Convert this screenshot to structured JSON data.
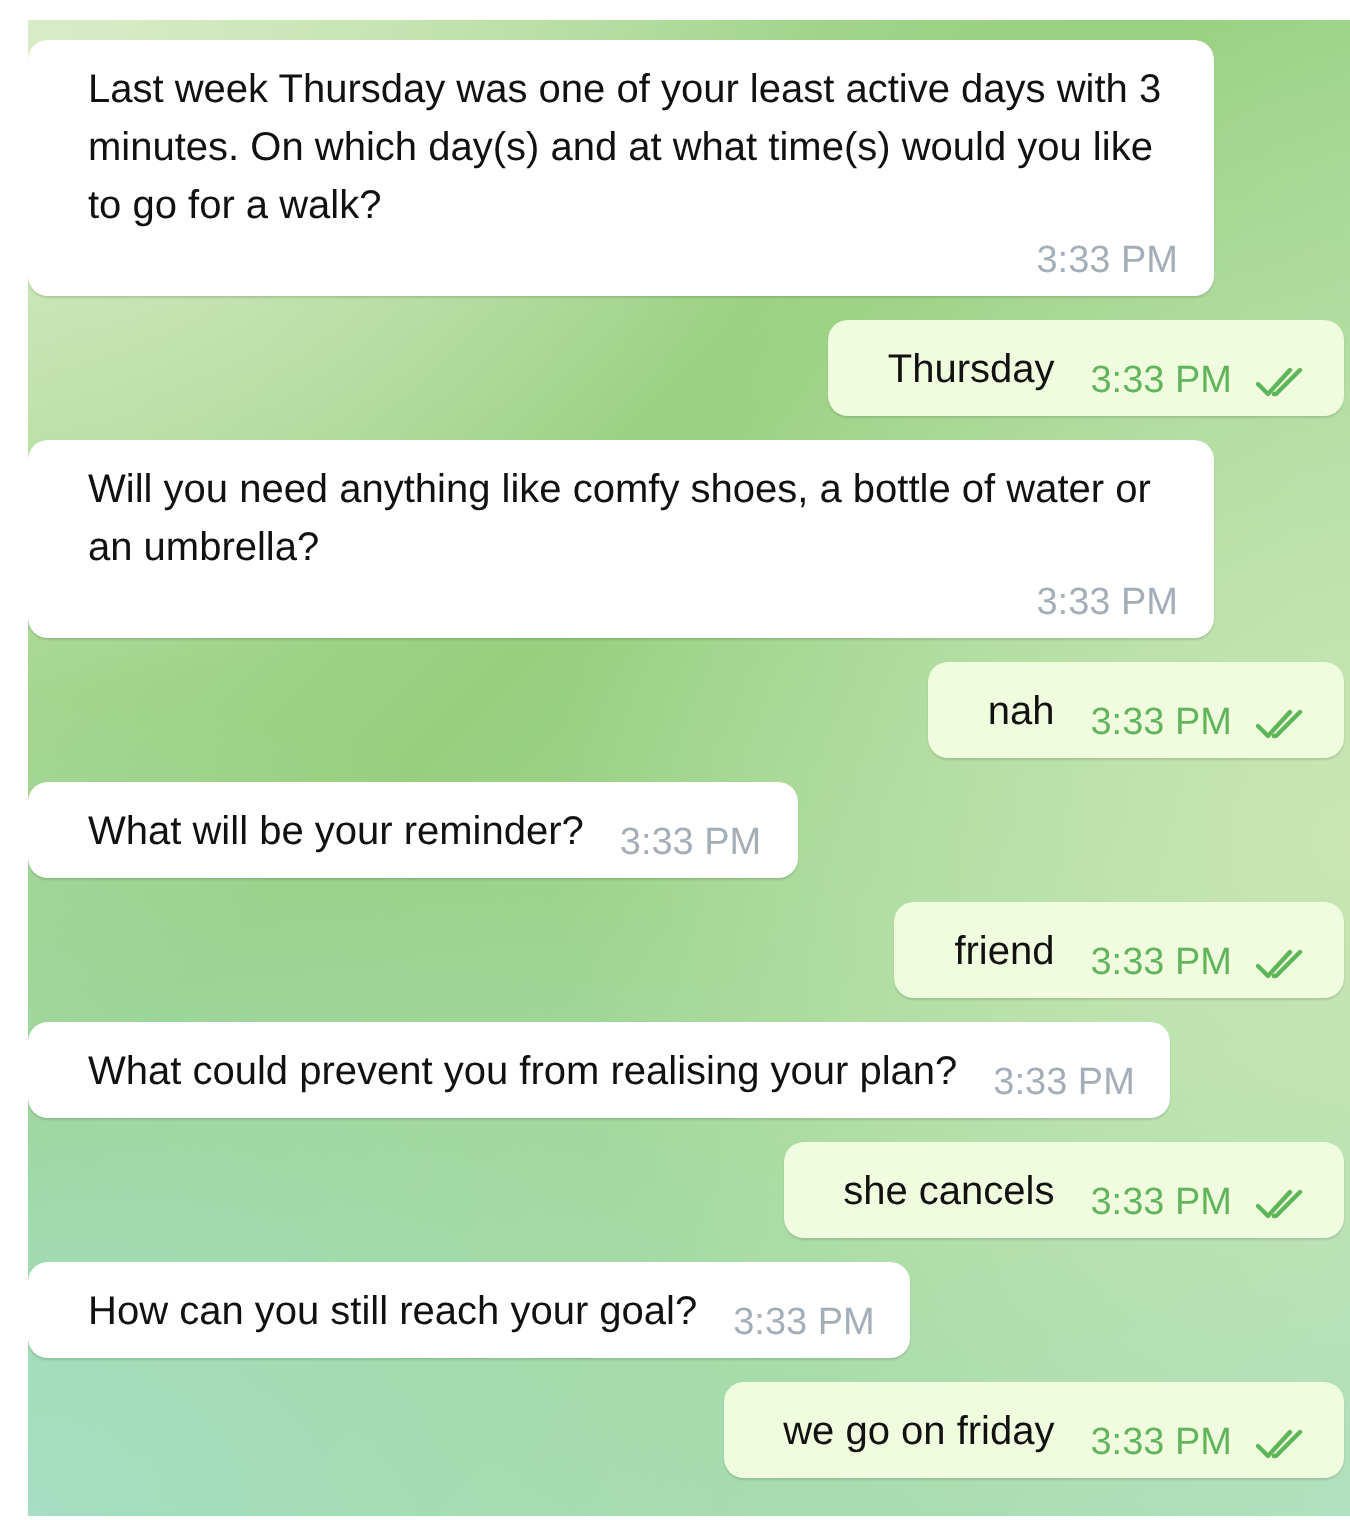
{
  "messages": [
    {
      "kind": "incoming",
      "text": "Last week Thursday was one of your least active days with 3 minutes. On which day(s) and at what time(s) would you like to go for a walk?",
      "time": "3:33 PM"
    },
    {
      "kind": "outgoing",
      "text": "Thursday",
      "time": "3:33 PM",
      "read": true
    },
    {
      "kind": "incoming",
      "text": "Will you need anything like comfy shoes, a bottle of water or an umbrella?",
      "time": "3:33 PM"
    },
    {
      "kind": "outgoing",
      "text": "nah",
      "time": "3:33 PM",
      "read": true
    },
    {
      "kind": "incoming",
      "text": "What will be your reminder?",
      "time": "3:33 PM"
    },
    {
      "kind": "outgoing",
      "text": "friend",
      "time": "3:33 PM",
      "read": true
    },
    {
      "kind": "incoming",
      "text": "What could prevent you from realising your plan?",
      "time": "3:33 PM"
    },
    {
      "kind": "outgoing",
      "text": "she cancels",
      "time": "3:33 PM",
      "read": true
    },
    {
      "kind": "incoming",
      "text": "How can you still reach your goal?",
      "time": "3:33 PM"
    },
    {
      "kind": "outgoing",
      "text": "we go on friday",
      "time": "3:33 PM",
      "read": true
    }
  ]
}
